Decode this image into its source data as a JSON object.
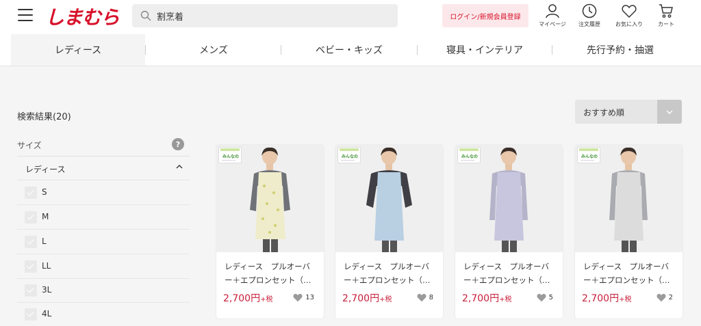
{
  "header": {
    "logo": "しまむら",
    "search_value": "割烹着",
    "login_label": "ログイン/新規会員登録",
    "icons": [
      {
        "name": "mypage-icon",
        "label": "マイページ"
      },
      {
        "name": "order-history-icon",
        "label": "注文履歴"
      },
      {
        "name": "favorite-icon",
        "label": "お気に入り"
      },
      {
        "name": "cart-icon",
        "label": "カート"
      }
    ]
  },
  "categories": [
    {
      "label": "レディース",
      "active": true
    },
    {
      "label": "メンズ"
    },
    {
      "label": "ベビー・キッズ"
    },
    {
      "label": "寝具・インテリア"
    },
    {
      "label": "先行予約・抽選"
    }
  ],
  "results": {
    "count_label": "検索結果(20)"
  },
  "sort": {
    "selected": "おすすめ順"
  },
  "filter": {
    "title": "サイズ",
    "help": "?",
    "group_label": "レディース",
    "sizes": [
      "S",
      "M",
      "L",
      "LL",
      "3L",
      "4L"
    ]
  },
  "products": [
    {
      "name": "レディース　プルオーバー＋エプロンセット（…",
      "price": "2,700円",
      "tax": "+税",
      "favorites": "13",
      "badge": "みんなの"
    },
    {
      "name": "レディース　プルオーバー＋エプロンセット（…",
      "price": "2,700円",
      "tax": "+税",
      "favorites": "8",
      "badge": "みんなの"
    },
    {
      "name": "レディース　プルオーバー＋エプロンセット（…",
      "price": "2,700円",
      "tax": "+税",
      "favorites": "5",
      "badge": "みんなの"
    },
    {
      "name": "レディース　プルオーバー＋エプロンセット（…",
      "price": "2,700円",
      "tax": "+税",
      "favorites": "2",
      "badge": "みんなの"
    }
  ],
  "colors": {
    "brand": "#d7122a",
    "price": "#c81e3a"
  }
}
